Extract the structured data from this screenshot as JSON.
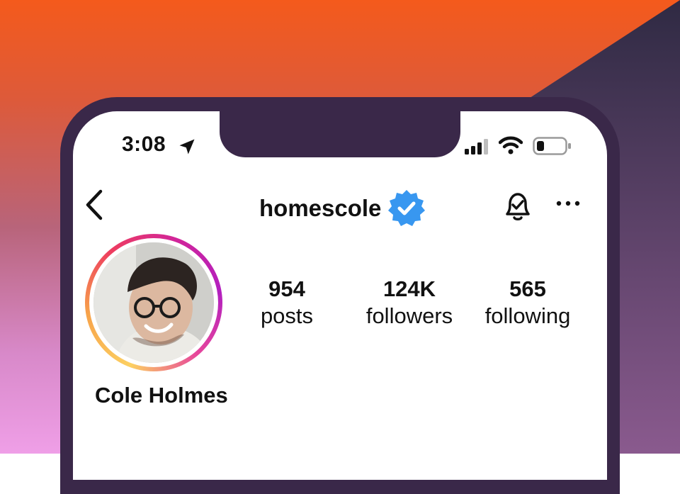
{
  "status_bar": {
    "time": "3:08",
    "icons": [
      "location-arrow-icon",
      "cellular-signal-icon",
      "wifi-icon",
      "battery-icon"
    ]
  },
  "header": {
    "username": "homescole",
    "verified": true,
    "icons": [
      "back-chevron-icon",
      "verified-badge-icon",
      "bell-icon",
      "more-icon"
    ]
  },
  "profile": {
    "display_name": "Cole Holmes",
    "stats": [
      {
        "value": "954",
        "label": "posts"
      },
      {
        "value": "124K",
        "label": "followers"
      },
      {
        "value": "565",
        "label": "following"
      }
    ]
  },
  "colors": {
    "accent_verified": "#3897f0",
    "background_top": "#f45a1c",
    "background_bottom": "#ef9fe7",
    "phone_frame": "#3a2849"
  }
}
